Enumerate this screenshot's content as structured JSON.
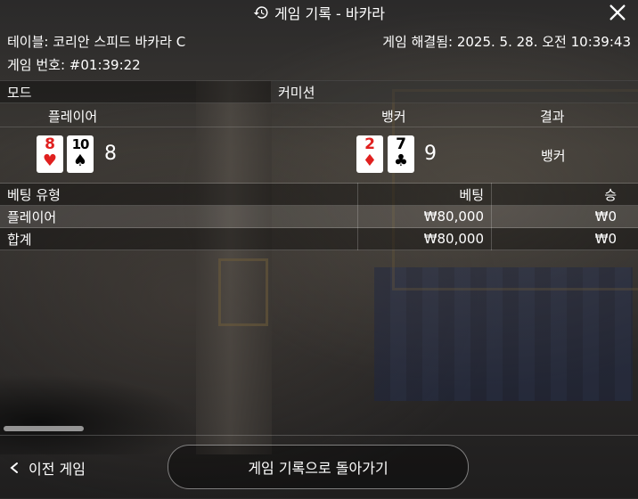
{
  "header": {
    "title": "게임 기록 - 바카라",
    "history_icon": "history-icon",
    "close_icon": "close-icon"
  },
  "info": {
    "table_label": "테이블: 코리안 스피드 바카라 C",
    "resolved_label": "게임 해결됨: 2025. 5. 28. 오전 10:39:43",
    "game_number_label": "게임 번호: #01:39:22"
  },
  "mode": {
    "label": "모드",
    "value": "커미션"
  },
  "result_header": {
    "player": "플레이어",
    "banker": "뱅커",
    "result": "결과"
  },
  "hands": {
    "player_cards": [
      {
        "rank": "8",
        "suit": "♥",
        "color": "#e0201f"
      },
      {
        "rank": "10",
        "suit": "♠",
        "color": "#000000"
      }
    ],
    "player_score": "8",
    "banker_cards": [
      {
        "rank": "2",
        "suit": "♦",
        "color": "#e0201f"
      },
      {
        "rank": "7",
        "suit": "♣",
        "color": "#000000"
      }
    ],
    "banker_score": "9",
    "result": "뱅커"
  },
  "bets": {
    "columns": [
      "베팅 유형",
      "베팅",
      "승"
    ],
    "rows": [
      {
        "type": "플레이어",
        "bet": "₩80,000",
        "win": "₩0"
      },
      {
        "type": "합계",
        "bet": "₩80,000",
        "win": "₩0"
      }
    ]
  },
  "footer": {
    "prev_label": "이전 게임",
    "prev_icon": "chevron-left-icon",
    "back_label": "게임 기록으로 돌아가기"
  }
}
